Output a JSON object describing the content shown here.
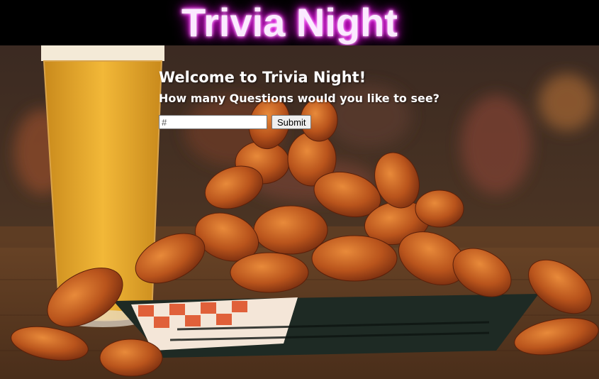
{
  "header": {
    "title": "Trivia Night"
  },
  "main": {
    "welcome": "Welcome to Trivia Night!",
    "question": "How many Questions would you like to see?",
    "input_placeholder": "#",
    "submit_label": "Submit"
  },
  "colors": {
    "neon_glow": "#ff00ff",
    "header_bg": "#000000",
    "text": "#ffffff"
  }
}
